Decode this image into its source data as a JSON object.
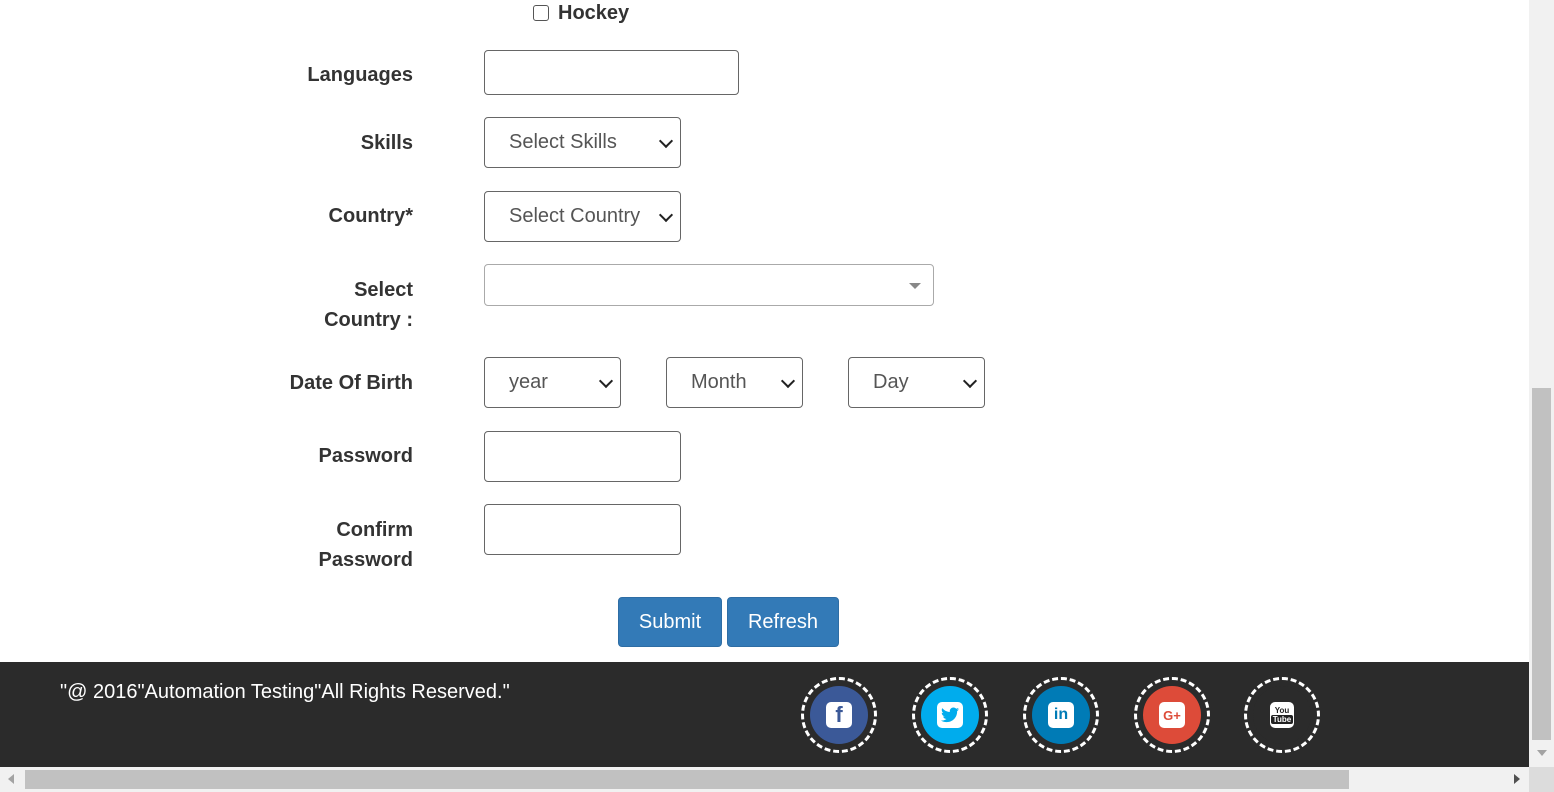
{
  "form": {
    "hobby": {
      "label": "Hockey",
      "checked": false
    },
    "languages": {
      "label": "Languages",
      "value": ""
    },
    "skills": {
      "label": "Skills",
      "selected": "Select Skills"
    },
    "country": {
      "label": "Country*",
      "selected": "Select Country"
    },
    "select_country": {
      "label_line1": "Select",
      "label_line2": "Country :",
      "value": ""
    },
    "dob": {
      "label": "Date Of Birth",
      "year": "year",
      "month": "Month",
      "day": "Day"
    },
    "password": {
      "label": "Password",
      "value": ""
    },
    "confirm_password": {
      "label_line1": "Confirm",
      "label_line2": "Password",
      "value": ""
    },
    "submit_label": "Submit",
    "refresh_label": "Refresh"
  },
  "footer": {
    "copyright": "\"@ 2016\"Automation Testing\"All Rights Reserved.\"",
    "social": [
      {
        "icon": "facebook-icon",
        "color": "#3b5998"
      },
      {
        "icon": "twitter-icon",
        "color": "#00aced"
      },
      {
        "icon": "linkedin-icon",
        "color": "#007bb6"
      },
      {
        "icon": "google-plus-icon",
        "color": "#dd4b39"
      },
      {
        "icon": "youtube-icon",
        "color": "#2b2b2b"
      }
    ]
  },
  "colors": {
    "button": "#337ab7",
    "footer_bg": "#2b2b2b"
  }
}
